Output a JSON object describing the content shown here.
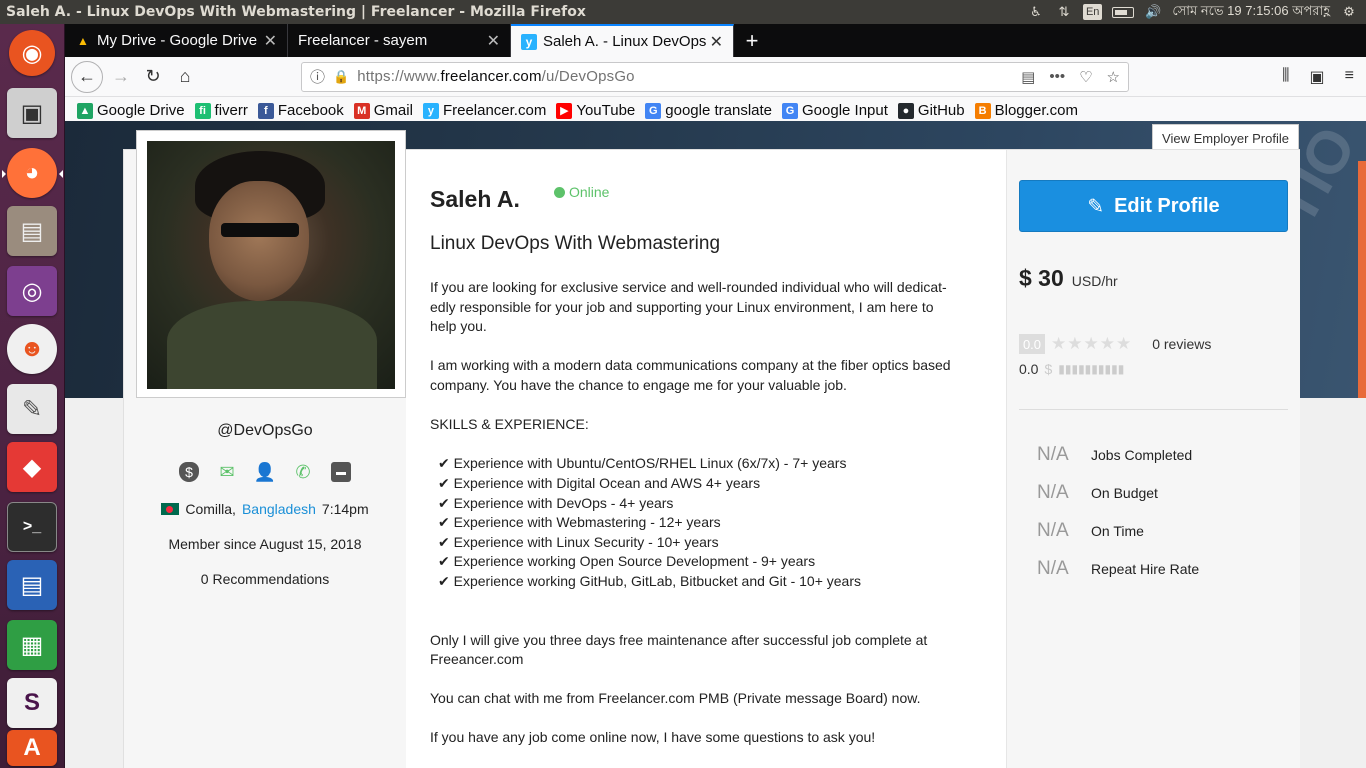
{
  "window": {
    "title": "Saleh A. - Linux DevOps With Webmastering | Freelancer - Mozilla Firefox",
    "tray": {
      "lang": "En",
      "clock": "সোম নভে 19  7:15:06 অপরাহ্ণ"
    }
  },
  "tabs": [
    {
      "label": "My Drive - Google Drive",
      "active": false
    },
    {
      "label": "Freelancer - sayem",
      "active": false
    },
    {
      "label": "Saleh A. - Linux DevOps",
      "active": true
    }
  ],
  "urlbar": {
    "prefix": "https://www.",
    "domain": "freelancer.com",
    "path": "/u/DevOpsGo"
  },
  "bookmarks": [
    {
      "label": "Google Drive",
      "icon": "google-drive-icon",
      "color": "#1fa463"
    },
    {
      "label": "fiverr",
      "icon": "fiverr-icon",
      "color": "#1dbf73"
    },
    {
      "label": "Facebook",
      "icon": "facebook-icon",
      "color": "#3b5998"
    },
    {
      "label": "Gmail",
      "icon": "gmail-icon",
      "color": "#d93025"
    },
    {
      "label": "Freelancer.com",
      "icon": "freelancer-icon",
      "color": "#29b2fe"
    },
    {
      "label": "YouTube",
      "icon": "youtube-icon",
      "color": "#ff0000"
    },
    {
      "label": "google translate",
      "icon": "google-icon",
      "color": "#4285f4"
    },
    {
      "label": "Google Input",
      "icon": "google-icon",
      "color": "#4285f4"
    },
    {
      "label": "GitHub",
      "icon": "github-icon",
      "color": "#24292e"
    },
    {
      "label": "Blogger.com",
      "icon": "blogger-icon",
      "color": "#f57d00"
    }
  ],
  "page": {
    "view_employer": "View Employer Profile",
    "username": "@DevOpsGo",
    "location": {
      "city": "Comilla,",
      "country": "Bangladesh",
      "time": "7:14pm"
    },
    "member_since": "Member since August 15, 2018",
    "recommendations": "0 Recommendations",
    "name": "Saleh A.",
    "status": "Online",
    "tagline": "Linux DevOps With Webmastering",
    "bio": {
      "p1a": "If you are looking for exclusive service and well-rounded individual who will dedicat-",
      "p1b": "edly responsible for your job and supporting your Linux environment, I am here to",
      "p1c": "help you.",
      "p2a": "I am working with a modern data communications company at the fiber optics based",
      "p2b": "company. You have the chance to engage me for your valuable job.",
      "skills_title": "SKILLS & EXPERIENCE:",
      "skills": [
        "✔ Experience with Ubuntu/CentOS/RHEL Linux (6x/7x) - 7+ years",
        "✔ Experience with Digital Ocean and AWS 4+ years",
        "✔ Experience with DevOps - 4+ years",
        "✔ Experience with Webmastering - 12+ years",
        "✔ Experience with Linux Security - 10+ years",
        "✔ Experience working Open Source Development - 9+ years",
        "✔ Experience working GitHub, GitLab, Bitbucket and Git - 10+ years"
      ],
      "p3a": "Only I will give you three days free maintenance after successful job complete at",
      "p3b": "Freeancer.com",
      "p4": "You can chat with me from Freelancer.com PMB (Private message Board) now.",
      "p5": "If you have any job come online now, I have some questions to ask you!"
    },
    "edit_profile": "Edit Profile",
    "rate": {
      "amount": "$ 30",
      "unit": "USD/hr"
    },
    "rating": {
      "score": "0.0",
      "stars": "★★★★★",
      "reviews": "0 reviews",
      "earnings": "0.0",
      "earn_symbol": "$",
      "earn_bar": "▮▮▮▮▮▮▮▮▮▮"
    },
    "stats": [
      {
        "value": "N/A",
        "label": "Jobs Completed"
      },
      {
        "value": "N/A",
        "label": "On Budget"
      },
      {
        "value": "N/A",
        "label": "On Time"
      },
      {
        "value": "N/A",
        "label": "Repeat Hire Rate"
      }
    ]
  }
}
